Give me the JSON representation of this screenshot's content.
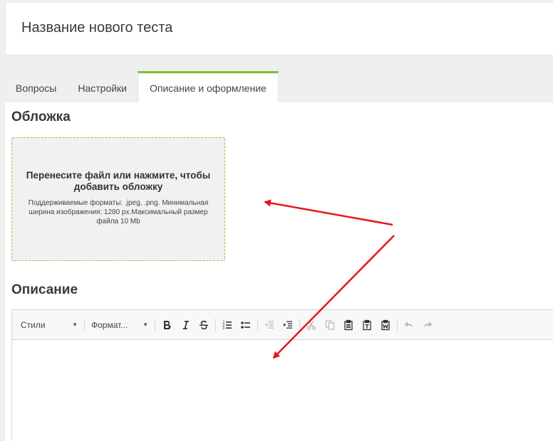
{
  "header": {
    "title": "Название нового теста"
  },
  "tabs": [
    {
      "label": "Вопросы",
      "active": false
    },
    {
      "label": "Настройки",
      "active": false
    },
    {
      "label": "Описание и оформление",
      "active": true
    }
  ],
  "cover": {
    "heading": "Обложка",
    "drop_title": "Перенесите файл или нажмите, чтобы добавить обложку",
    "drop_hint": "Поддерживаемые форматы: .jpeg, .png. Минимальная ширина изображения: 1280 px.Максимальный размер файла 10 Mb"
  },
  "description": {
    "heading": "Описание",
    "editor": {
      "styles_label": "Стили",
      "format_label": "Формат...",
      "toolbar_icons": [
        "bold-icon",
        "italic-icon",
        "strikethrough-icon",
        "numbered-list-icon",
        "bulleted-list-icon",
        "decrease-indent-icon",
        "increase-indent-icon",
        "cut-icon",
        "copy-icon",
        "paste-icon",
        "paste-as-text-icon",
        "paste-from-word-icon",
        "undo-icon",
        "redo-icon"
      ]
    }
  },
  "colors": {
    "accent": "#7ac12c",
    "annotation_arrow": "#e8141c"
  }
}
